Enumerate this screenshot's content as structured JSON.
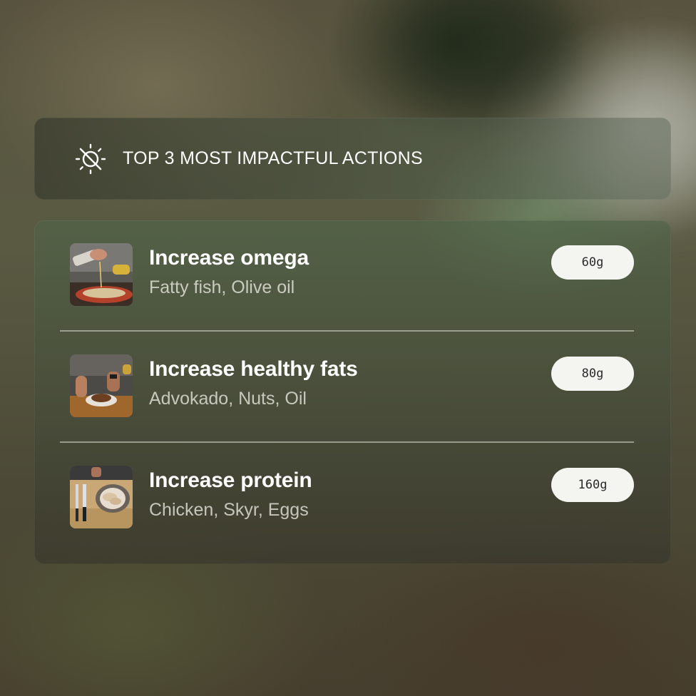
{
  "header": {
    "title": "TOP 3 MOST IMPACTFUL ACTIONS",
    "icon": "sun-off-icon"
  },
  "actions": [
    {
      "title": "Increase omega",
      "subtitle": "Fatty fish, Olive oil",
      "amount": "60g",
      "thumb": "food-photo-olive-oil-pour"
    },
    {
      "title": "Increase healthy fats",
      "subtitle": "Advokado, Nuts, Oil",
      "amount": "80g",
      "thumb": "food-photo-plate-prep"
    },
    {
      "title": "Increase protein",
      "subtitle": "Chicken, Skyr, Eggs",
      "amount": "160g",
      "thumb": "food-photo-chicken-board"
    }
  ],
  "colors": {
    "pill_bg": "#f4f4f1",
    "pill_text": "#2a2a2a",
    "title_text": "#ffffff"
  }
}
